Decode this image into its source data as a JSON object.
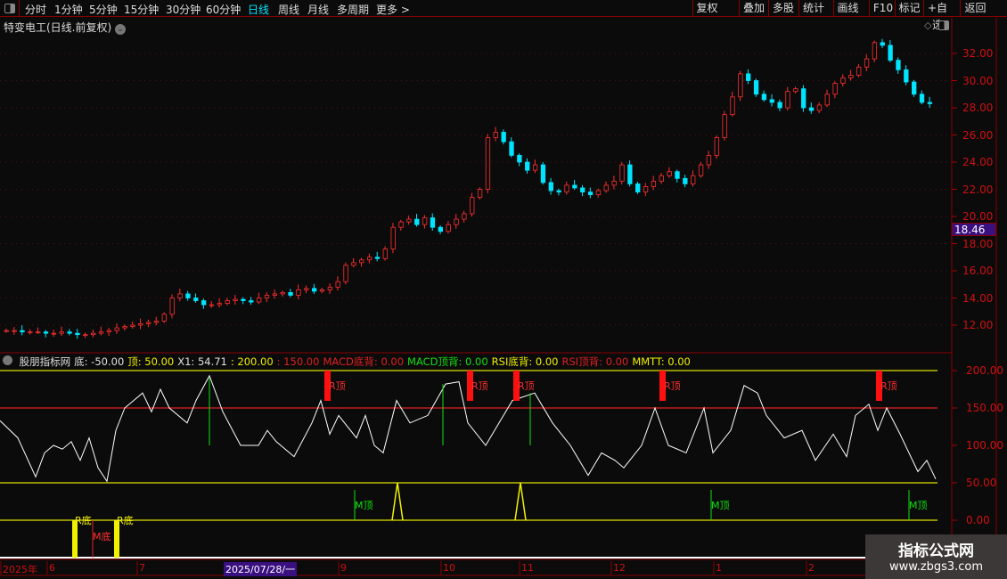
{
  "toolbar": {
    "periods": [
      "分时",
      "1分钟",
      "5分钟",
      "15分钟",
      "30分钟",
      "60分钟",
      "日线",
      "周线",
      "月线",
      "多周期",
      "更多 >"
    ],
    "active": "日线",
    "buttons": [
      "复权",
      "叠加",
      "多股",
      "统计",
      "画线",
      "F10",
      "标记",
      "+自选",
      "返回"
    ]
  },
  "title": "特变电工(日线.前复权)",
  "price_axis": {
    "ticks": [
      "32.00",
      "30.00",
      "28.00",
      "26.00",
      "24.00",
      "22.00",
      "20.00",
      "18.00",
      "16.00",
      "14.00",
      "12.00"
    ],
    "current": "18.46"
  },
  "indicator": {
    "name": "股朋指标网",
    "items": [
      {
        "text": "底: -50.00",
        "color": "#e0e0e0"
      },
      {
        "text": "顶: 50.00",
        "color": "#f0f000"
      },
      {
        "text": "X1: 54.71",
        "color": "#e0e0e0"
      },
      {
        "text": ": 200.00",
        "color": "#f0f000"
      },
      {
        "text": ": 150.00",
        "color": "#e02020"
      },
      {
        "text": "MACD底背: 0.00",
        "color": "#e02020"
      },
      {
        "text": "MACD顶背: 0.00",
        "color": "#10e010"
      },
      {
        "text": "RSI底背: 0.00",
        "color": "#f0f000"
      },
      {
        "text": "RSI顶背: 0.00",
        "color": "#e02020"
      },
      {
        "text": "MMTT: 0.00",
        "color": "#f0f000"
      }
    ],
    "axis": [
      "200.00",
      "150.00",
      "100.00",
      "50.00",
      "0.00"
    ],
    "labels": {
      "r_top": "R顶",
      "m_top": "M顶",
      "r_bottom": "R底",
      "m_bottom": "M底"
    }
  },
  "time_axis": {
    "labels": [
      "2025年",
      "6",
      "7",
      "2025/07/28/一",
      "9",
      "10",
      "11",
      "12",
      "1",
      "2"
    ]
  },
  "watermark": {
    "title": "指标公式网",
    "url": "www.zbgs3.com"
  },
  "chart_data": {
    "type": "candlestick",
    "price_closes": [
      11.6,
      11.6,
      11.5,
      11.5,
      11.5,
      11.4,
      11.4,
      11.5,
      11.4,
      11.3,
      11.3,
      11.4,
      11.5,
      11.6,
      11.8,
      11.9,
      12.0,
      12.1,
      12.2,
      12.3,
      12.8,
      14.0,
      14.3,
      14.0,
      13.8,
      13.5,
      13.5,
      13.6,
      13.8,
      13.9,
      13.8,
      13.7,
      14.0,
      14.2,
      14.3,
      14.4,
      14.2,
      14.6,
      14.7,
      14.5,
      14.6,
      14.8,
      15.2,
      16.4,
      16.6,
      16.8,
      17.0,
      16.9,
      17.6,
      19.2,
      19.6,
      19.8,
      19.4,
      19.9,
      19.2,
      18.9,
      19.4,
      19.8,
      20.2,
      21.4,
      22.0,
      25.8,
      26.2,
      25.5,
      24.5,
      24.0,
      23.4,
      23.8,
      22.5,
      21.9,
      21.8,
      22.3,
      22.1,
      21.8,
      21.6,
      21.9,
      22.3,
      22.6,
      23.8,
      22.4,
      21.8,
      22.2,
      22.6,
      23.0,
      23.3,
      22.8,
      22.4,
      23.0,
      23.8,
      24.5,
      25.8,
      27.5,
      28.8,
      30.5,
      30.0,
      29.0,
      28.6,
      28.4,
      28.0,
      29.2,
      29.4,
      28.0,
      27.8,
      28.2,
      29.0,
      29.8,
      30.2,
      30.4,
      31.0,
      31.6,
      32.8,
      32.6,
      31.5,
      30.8,
      29.9,
      29.0,
      28.4,
      28.3
    ],
    "indicator_series": {
      "x_points": [
        0,
        20,
        40,
        50,
        60,
        70,
        80,
        90,
        100,
        110,
        120,
        130,
        140,
        160,
        170,
        180,
        190,
        210,
        220,
        235,
        250,
        270,
        290,
        300,
        310,
        330,
        350,
        360,
        370,
        380,
        400,
        410,
        420,
        430,
        445,
        460,
        480,
        500,
        515,
        525,
        545,
        560,
        575,
        600,
        620,
        640,
        660,
        675,
        690,
        700,
        720,
        735,
        750,
        770,
        790,
        800,
        820,
        835,
        850,
        860,
        880,
        900,
        915,
        935,
        950,
        960,
        975,
        985,
        995,
        1010,
        1030,
        1040,
        1050
      ],
      "values": [
        133,
        110,
        58,
        90,
        100,
        95,
        105,
        80,
        110,
        70,
        52,
        120,
        150,
        170,
        145,
        175,
        150,
        130,
        160,
        193,
        145,
        100,
        100,
        120,
        105,
        85,
        130,
        160,
        115,
        140,
        110,
        140,
        100,
        90,
        160,
        130,
        140,
        182,
        185,
        130,
        100,
        130,
        160,
        170,
        130,
        100,
        60,
        90,
        80,
        70,
        100,
        150,
        100,
        90,
        150,
        90,
        120,
        180,
        170,
        140,
        110,
        120,
        80,
        115,
        85,
        140,
        155,
        120,
        150,
        115,
        65,
        80,
        55
      ]
    },
    "reference_lines": [
      200,
      150,
      50,
      0,
      -50
    ],
    "ylim_price": [
      11,
      34
    ],
    "ylim_indicator": [
      -50,
      220
    ]
  }
}
